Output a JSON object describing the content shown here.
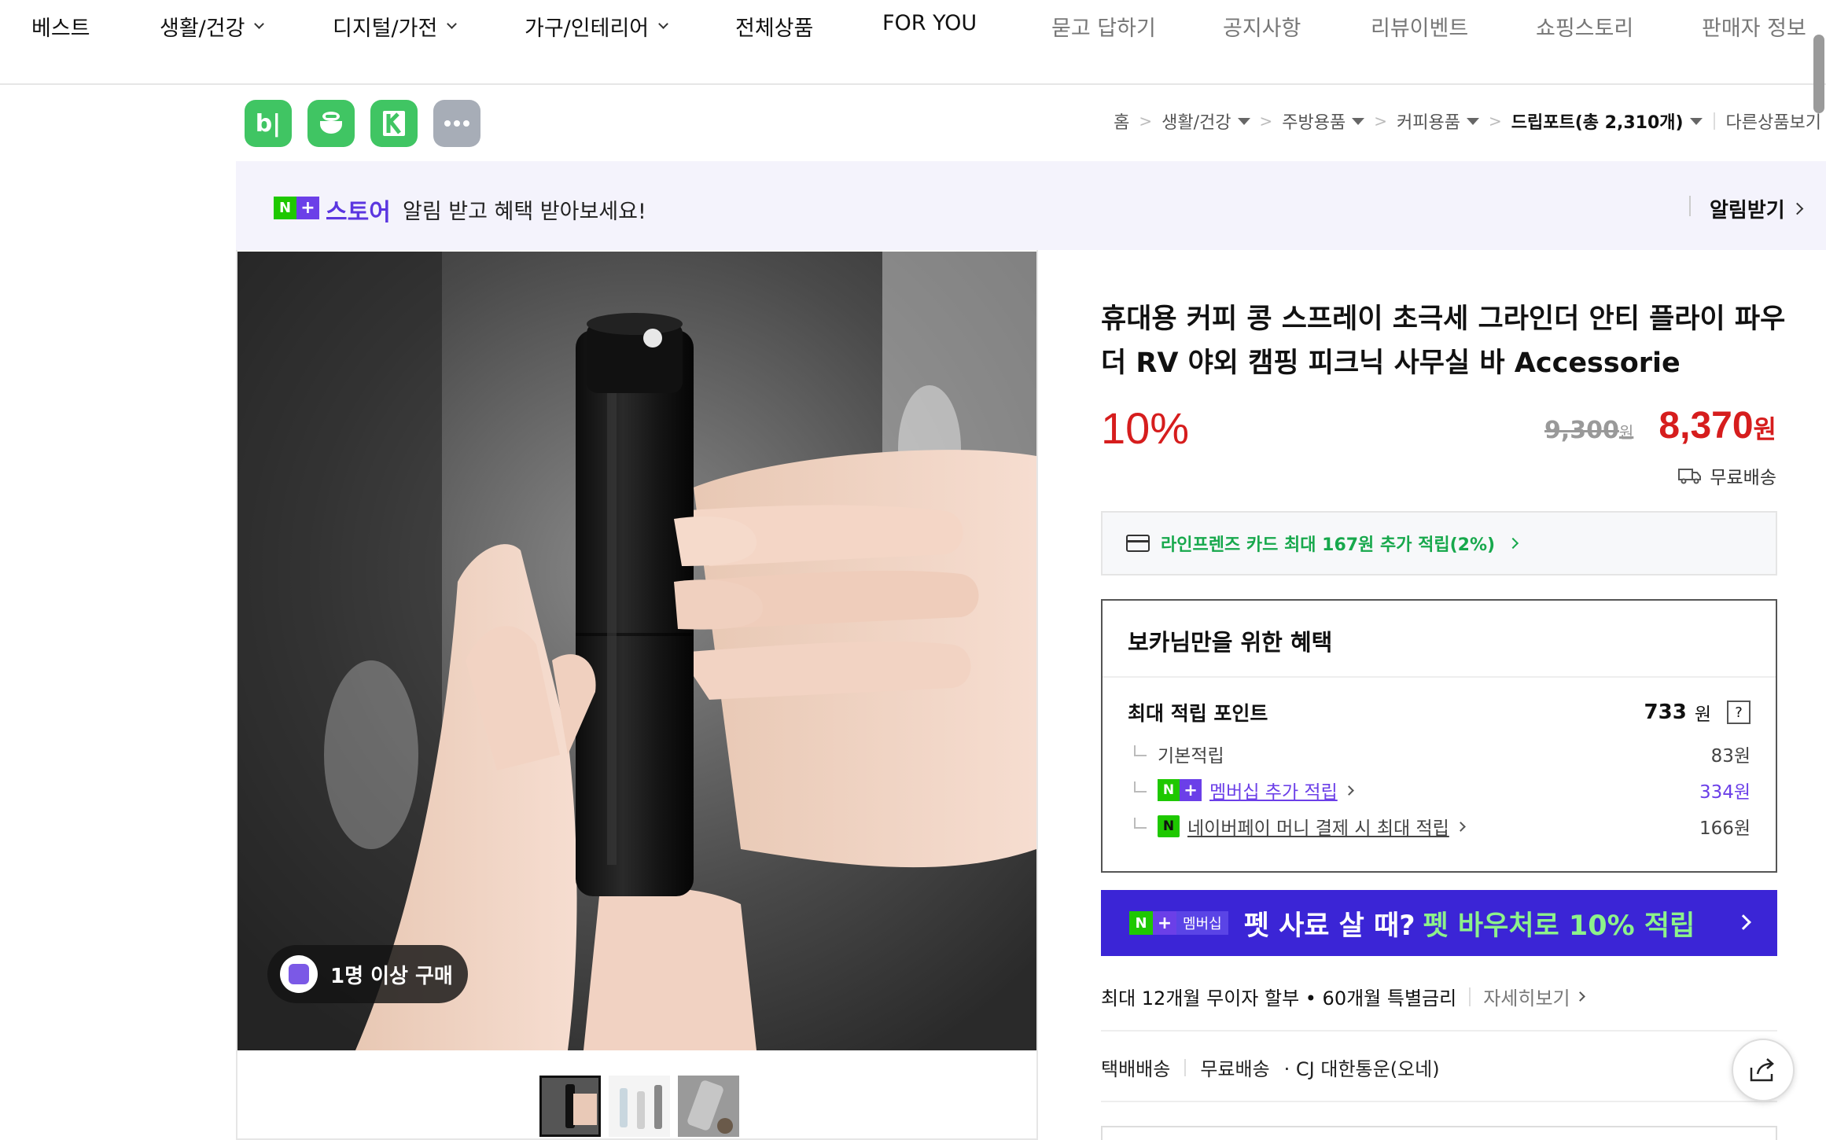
{
  "nav": {
    "items": [
      {
        "label": "베스트"
      },
      {
        "label": "생활/건강"
      },
      {
        "label": "디지털/가전"
      },
      {
        "label": "가구/인테리어"
      },
      {
        "label": "전체상품"
      },
      {
        "label": "FOR YOU"
      },
      {
        "label": "묻고 답하기"
      },
      {
        "label": "공지사항"
      },
      {
        "label": "리뷰이벤트"
      },
      {
        "label": "쇼핑스토리"
      },
      {
        "label": "판매자 정보"
      }
    ]
  },
  "store_icons": {
    "bi_label": "b|"
  },
  "breadcrumb": {
    "home": "홈",
    "c1": "생활/건강",
    "c2": "주방용품",
    "c3": "커피용품",
    "c4": "드립포트(총 2,310개)",
    "other": "다른상품보기"
  },
  "notify": {
    "badge_n": "N",
    "badge_plus": "+",
    "store": "스토어",
    "message": "알림 받고 혜택 받아보세요!",
    "action": "알림받기"
  },
  "image": {
    "buyers_badge": "1명 이상 구매"
  },
  "product": {
    "title": "휴대용 커피 콩 스프레이 초극세 그라인더 안티 플라이 파우더 RV 야외 캠핑 피크닉 사무실 바 Accessorie",
    "discount": "10%",
    "original_price": "9,300",
    "original_unit": "원",
    "sale_price": "8,370",
    "sale_unit": "원",
    "shipping_badge": "무료배송"
  },
  "card_promo": {
    "text": "라인프렌즈 카드 최대 167원 추가 적립(2%)"
  },
  "benefit": {
    "title": "보카님만을 위한 혜택",
    "max_label": "최대 적립 포인트",
    "max_value": "733",
    "max_unit": "원",
    "help": "?",
    "basic_label": "기본적립",
    "basic_value": "83원",
    "member_label": "멤버십 추가 적립",
    "member_value": "334원",
    "npay_label": "네이버페이 머니 결제 시 최대 적립",
    "npay_value": "166원",
    "npay_mark": "N"
  },
  "pet_banner": {
    "badge_member": "멤버십",
    "text1": "펫 사료 살 때?",
    "text2": "펫 바우처로 10% 적립"
  },
  "installment": {
    "text": "최대 12개월 무이자 할부 • 60개월 특별금리",
    "detail": "자세히보기"
  },
  "shipping": {
    "type": "택배배송",
    "fee": "무료배송",
    "carrier": "· CJ 대한통운(오네)"
  },
  "colors": {
    "accent_purple": "#5b36e0",
    "price_red": "#d61d1d",
    "naver_green": "#1ec800",
    "banner_blue": "#3b25d6"
  }
}
